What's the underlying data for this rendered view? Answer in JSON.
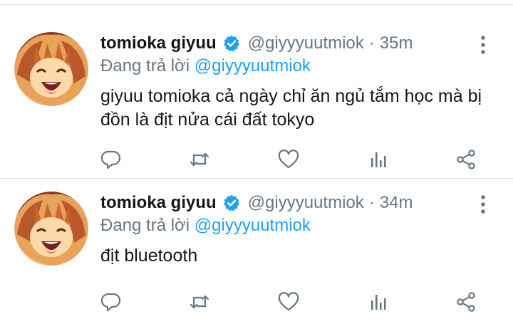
{
  "tweets": [
    {
      "name": "tomioka giyuu",
      "handle": "@giyyyuutmiok",
      "separator": "·",
      "time": "35m",
      "reply_prefix": "Đang trả lời",
      "reply_to": "@giyyyuutmiok",
      "text": "giyuu tomioka cả ngày chỉ ăn ngủ tắm học mà bị đồn là địt nửa cái đất tokyo"
    },
    {
      "name": "tomioka giyuu",
      "handle": "@giyyyuutmiok",
      "separator": "·",
      "time": "34m",
      "reply_prefix": "Đang trả lời",
      "reply_to": "@giyyyuutmiok",
      "text": "địt bluetooth"
    }
  ],
  "icons": {
    "reply": "reply-icon",
    "retweet": "retweet-icon",
    "like": "heart-icon",
    "analytics": "analytics-icon",
    "share": "share-icon",
    "more": "more-vertical-icon",
    "verified": "verified-badge-icon"
  },
  "colors": {
    "accent": "#1da1f2",
    "text": "#14171a",
    "secondary": "#657786",
    "divider": "#dfe3e7"
  }
}
